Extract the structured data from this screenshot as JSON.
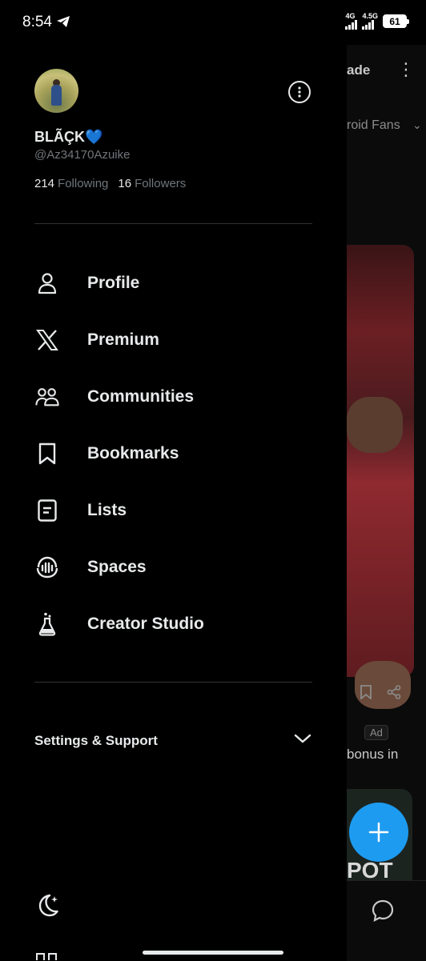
{
  "status_bar": {
    "time": "8:54",
    "network_1": "4G",
    "network_2": "4.5G",
    "battery": "61"
  },
  "background": {
    "title_fragment": "ade",
    "tab_fragment": "roid Fans",
    "ad_badge": "Ad",
    "ad_text_fragment": "bonus in",
    "ad_image_text": "POT"
  },
  "profile": {
    "name": "BLÃÇK💙",
    "handle": "@Az34170Azuike",
    "following_count": "214",
    "following_label": "Following",
    "followers_count": "16",
    "followers_label": "Followers"
  },
  "menu": {
    "items": [
      {
        "label": "Profile",
        "icon": "person-icon"
      },
      {
        "label": "Premium",
        "icon": "x-logo-icon"
      },
      {
        "label": "Communities",
        "icon": "communities-icon"
      },
      {
        "label": "Bookmarks",
        "icon": "bookmark-icon"
      },
      {
        "label": "Lists",
        "icon": "list-icon"
      },
      {
        "label": "Spaces",
        "icon": "spaces-icon"
      },
      {
        "label": "Creator Studio",
        "icon": "flask-icon"
      }
    ]
  },
  "settings": {
    "label": "Settings & Support"
  },
  "colors": {
    "background": "#000000",
    "text_primary": "#e7e9ea",
    "text_secondary": "#71767b",
    "divider": "#2f3336",
    "accent": "#1d9bf0"
  }
}
